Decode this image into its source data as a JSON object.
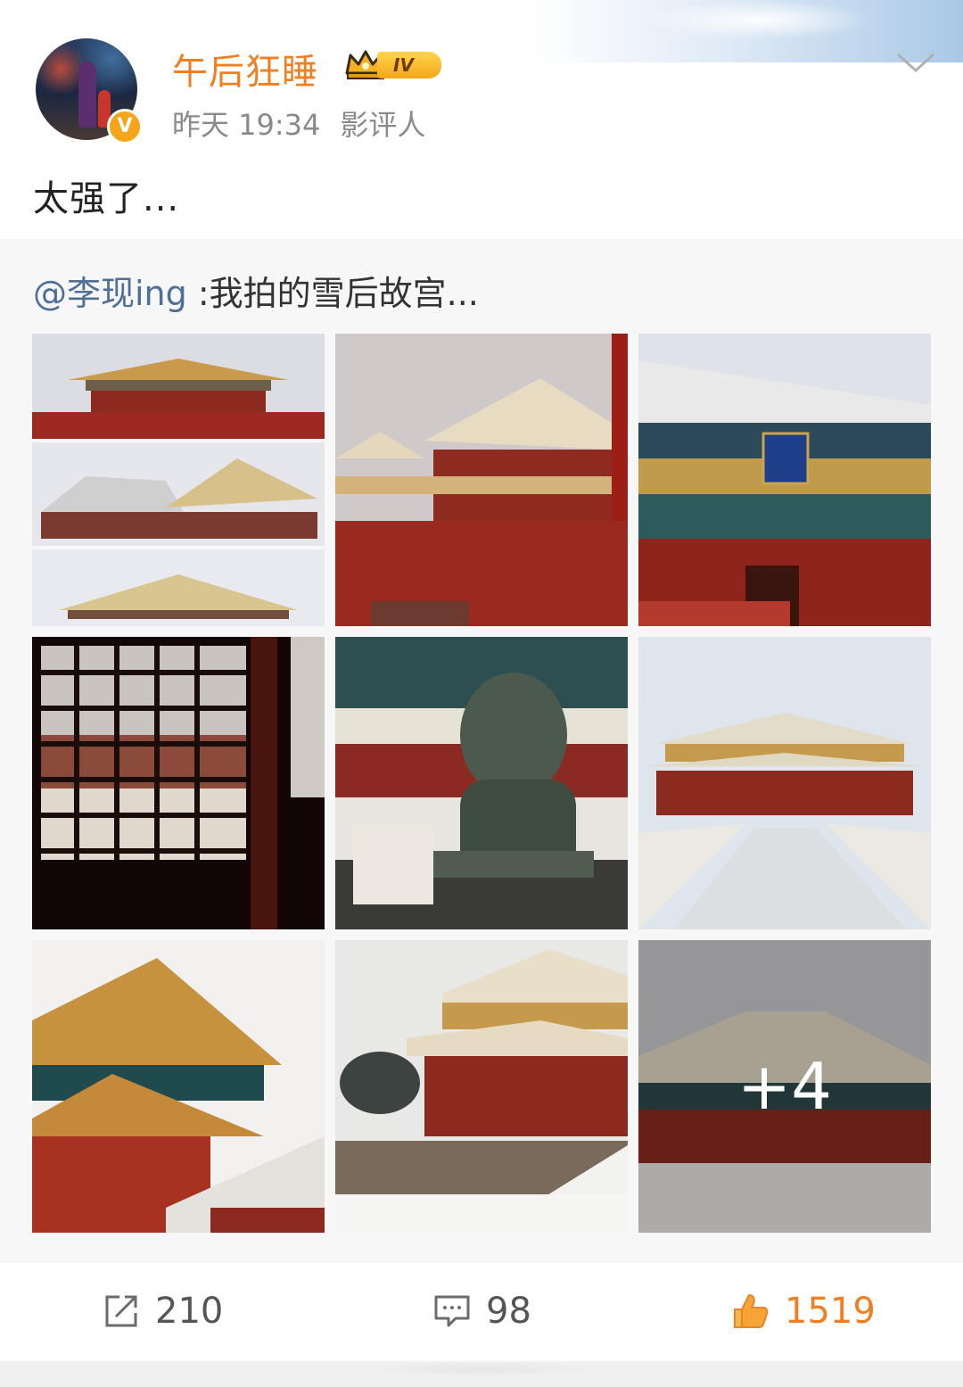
{
  "header": {
    "username": "午后狂睡",
    "level_badge": "IV",
    "time": "昨天 19:34",
    "role": "影评人",
    "verified_badge": "V"
  },
  "post": {
    "text": "太强了..."
  },
  "repost": {
    "mention": "@李现ing",
    "text": " :我拍的雪后故宫..."
  },
  "images": {
    "more_count": "+4"
  },
  "actions": {
    "share_count": "210",
    "comment_count": "98",
    "like_count": "1519"
  },
  "colors": {
    "username": "#f07f22",
    "mention": "#4f6f96",
    "like": "#f07f22"
  },
  "icons": [
    "chevron-down-icon",
    "share-icon",
    "comment-icon",
    "like-icon",
    "crown-icon"
  ]
}
